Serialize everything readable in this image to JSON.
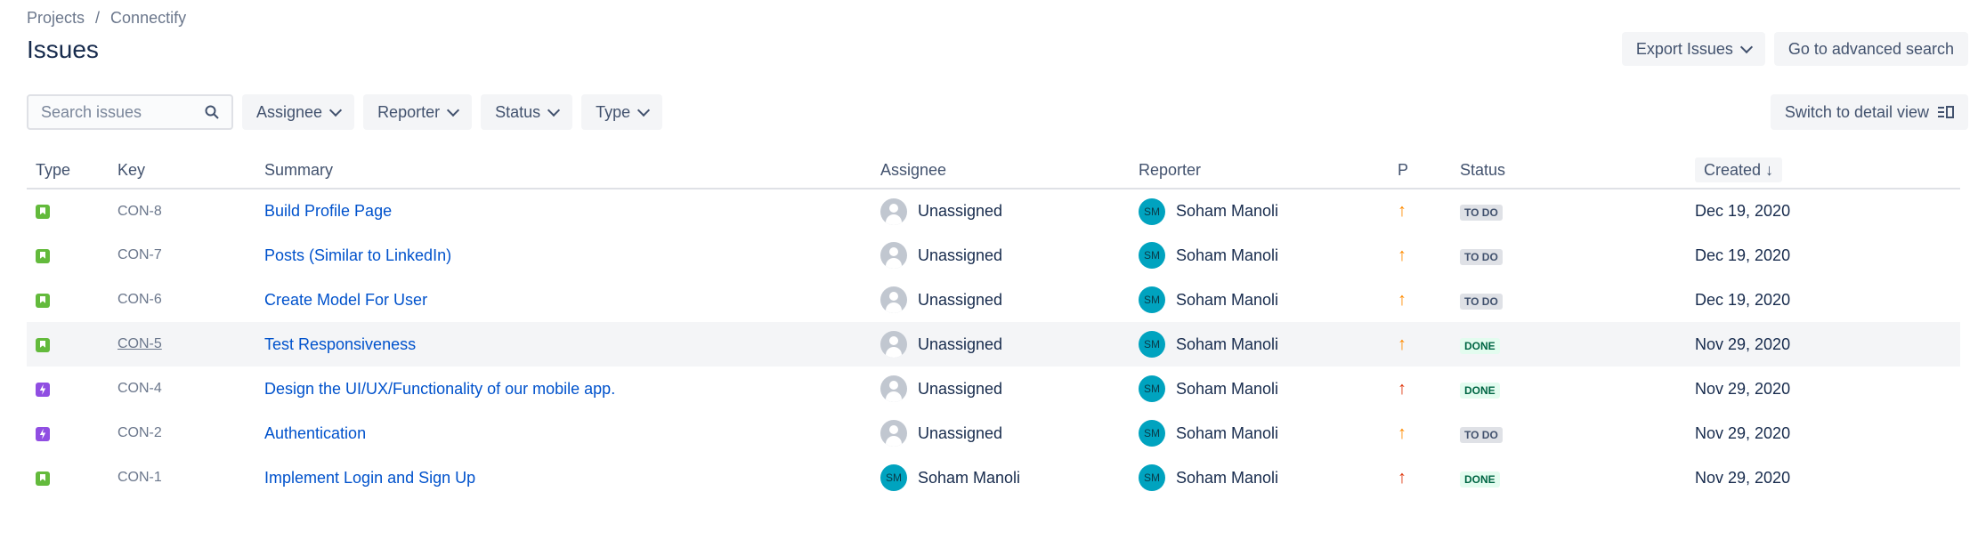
{
  "breadcrumb": {
    "projects": "Projects",
    "separator": "/",
    "project": "Connectify"
  },
  "page_title": "Issues",
  "actions": {
    "export": "Export Issues",
    "advanced_search": "Go to advanced search",
    "switch_view": "Switch to detail view"
  },
  "search": {
    "placeholder": "Search issues",
    "value": ""
  },
  "filters": {
    "assignee": "Assignee",
    "reporter": "Reporter",
    "status": "Status",
    "type": "Type"
  },
  "columns": {
    "type": "Type",
    "key": "Key",
    "summary": "Summary",
    "assignee": "Assignee",
    "reporter": "Reporter",
    "priority": "P",
    "status": "Status",
    "created": "Created",
    "sort_arrow": "↓"
  },
  "issues": [
    {
      "type": "story",
      "key": "CON-8",
      "summary": "Build Profile Page",
      "assignee": "Unassigned",
      "reporter_initials": "SM",
      "reporter": "Soham Manoli",
      "priority_arrow": "↑",
      "priority_color": "#ff8b00",
      "status": "TO DO",
      "created": "Dec 19, 2020"
    },
    {
      "type": "story",
      "key": "CON-7",
      "summary": "Posts (Similar to LinkedIn)",
      "assignee": "Unassigned",
      "reporter_initials": "SM",
      "reporter": "Soham Manoli",
      "priority_arrow": "↑",
      "priority_color": "#ff8b00",
      "status": "TO DO",
      "created": "Dec 19, 2020"
    },
    {
      "type": "story",
      "key": "CON-6",
      "summary": "Create Model For User",
      "assignee": "Unassigned",
      "reporter_initials": "SM",
      "reporter": "Soham Manoli",
      "priority_arrow": "↑",
      "priority_color": "#ff8b00",
      "status": "TO DO",
      "created": "Dec 19, 2020"
    },
    {
      "type": "story",
      "key": "CON-5",
      "summary": "Test Responsiveness",
      "assignee": "Unassigned",
      "reporter_initials": "SM",
      "reporter": "Soham Manoli",
      "priority_arrow": "↑",
      "priority_color": "#ff8b00",
      "status": "DONE",
      "created": "Nov 29, 2020"
    },
    {
      "type": "epic",
      "key": "CON-4",
      "summary": "Design the UI/UX/Functionality of our mobile app.",
      "assignee": "Unassigned",
      "reporter_initials": "SM",
      "reporter": "Soham Manoli",
      "priority_arrow": "↑",
      "priority_color": "#de350b",
      "status": "DONE",
      "created": "Nov 29, 2020"
    },
    {
      "type": "epic",
      "key": "CON-2",
      "summary": "Authentication",
      "assignee": "Unassigned",
      "reporter_initials": "SM",
      "reporter": "Soham Manoli",
      "priority_arrow": "↑",
      "priority_color": "#ff8b00",
      "status": "TO DO",
      "created": "Nov 29, 2020"
    },
    {
      "type": "story",
      "key": "CON-1",
      "summary": "Implement Login and Sign Up",
      "assignee": "Soham Manoli",
      "assignee_initials": "SM",
      "reporter_initials": "SM",
      "reporter": "Soham Manoli",
      "priority_arrow": "↑",
      "priority_color": "#de350b",
      "status": "DONE",
      "created": "Nov 29, 2020"
    }
  ]
}
